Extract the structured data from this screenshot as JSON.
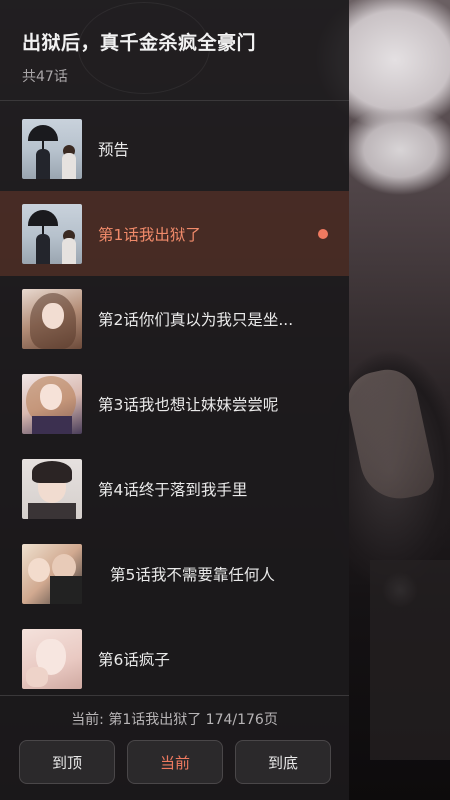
{
  "drawer": {
    "title": "出狱后，真千金杀疯全豪门",
    "count": "共47话"
  },
  "chapters": [
    {
      "label": "预告",
      "thumb": "umbrella-couple"
    },
    {
      "label": "第1话我出狱了",
      "thumb": "umbrella-couple",
      "active": true
    },
    {
      "label": "第2话你们真以为我只是坐...",
      "thumb": "girl-portrait"
    },
    {
      "label": "第3话我也想让妹妹尝尝呢",
      "thumb": "girl-dress"
    },
    {
      "label": "第4话终于落到我手里",
      "thumb": "boy-portrait"
    },
    {
      "label": "第5话我不需要靠任何人",
      "thumb": "couple"
    },
    {
      "label": "第6话疯子",
      "thumb": "girl-crazy"
    }
  ],
  "footer": {
    "current_text": "当前: 第1话我出狱了 174/176页",
    "btn_top": "到顶",
    "btn_current": "当前",
    "btn_bottom": "到底"
  },
  "colors": {
    "accent": "#f07a60",
    "panel": "#1c1a1c",
    "active_row": "#5a3226"
  }
}
